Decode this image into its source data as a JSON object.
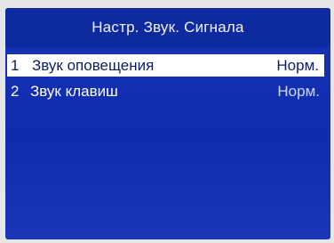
{
  "screen": {
    "title": "Настр. Звук. Сигнала"
  },
  "menu": {
    "items": [
      {
        "number": "1",
        "label": "Звук оповещения",
        "value": "Норм.",
        "selected": true
      },
      {
        "number": "2",
        "label": "Звук клавиш",
        "value": "Норм.",
        "selected": false
      }
    ]
  },
  "colors": {
    "background": "#1430b2",
    "title_bar": "#0d2a9e",
    "selection": "#ffffff",
    "text": "#ffffff"
  }
}
